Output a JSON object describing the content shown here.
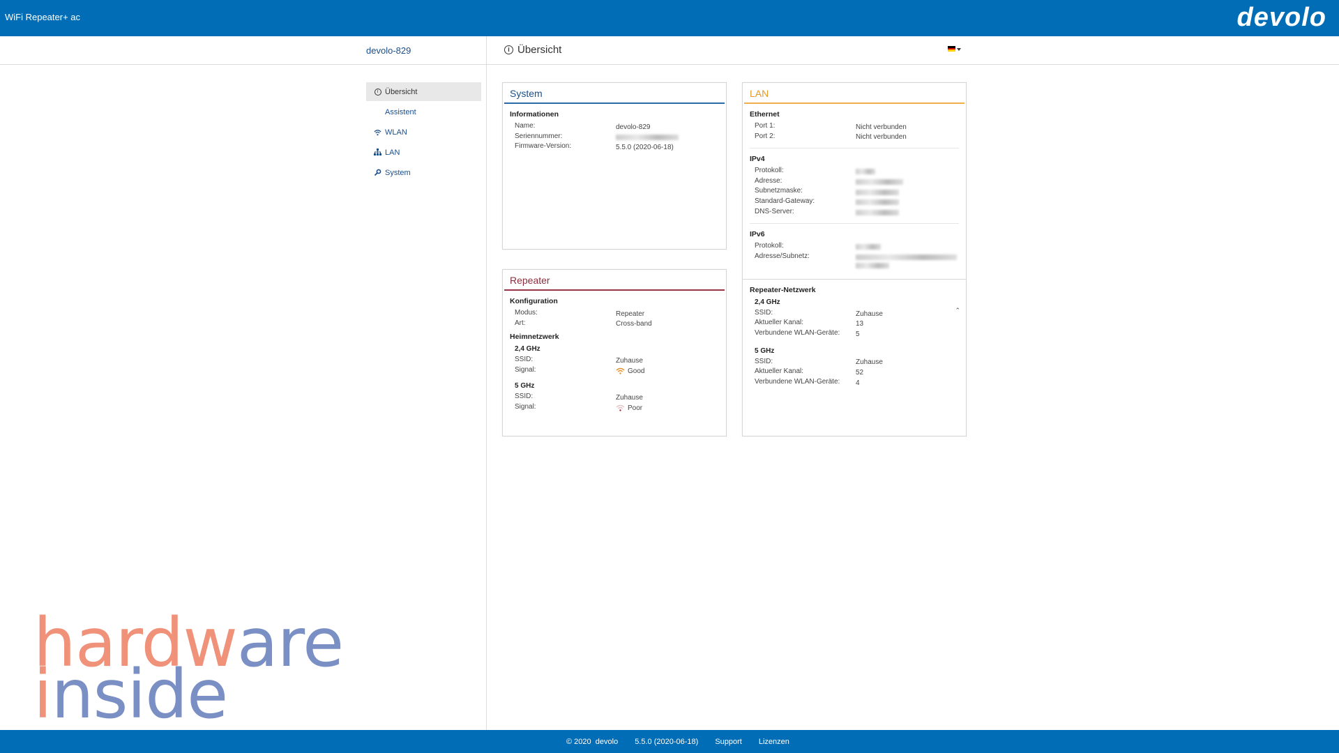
{
  "header": {
    "product": "WiFi Repeater+ ac",
    "brand": "devolo"
  },
  "subbar": {
    "device_name": "devolo-829",
    "page_title": "Übersicht"
  },
  "nav": {
    "items": [
      {
        "label": "Übersicht",
        "icon": "info-icon"
      },
      {
        "label": "Assistent",
        "icon": ""
      },
      {
        "label": "WLAN",
        "icon": "wifi-icon"
      },
      {
        "label": "LAN",
        "icon": "network-icon"
      },
      {
        "label": "System",
        "icon": "gear-icon"
      }
    ]
  },
  "system_card": {
    "title": "System",
    "section": "Informationen",
    "rows": [
      {
        "label": "Name:",
        "value": "devolo-829"
      },
      {
        "label": "Seriennummer:",
        "value": ""
      },
      {
        "label": "Firmware-Version:",
        "value": "5.5.0 (2020-06-18)"
      }
    ]
  },
  "repeater_card": {
    "title": "Repeater",
    "config_section": "Konfiguration",
    "config_rows": [
      {
        "label": "Modus:",
        "value": "Repeater"
      },
      {
        "label": "Art:",
        "value": "Cross-band"
      }
    ],
    "home_section": "Heimnetzwerk",
    "band24": {
      "title": "2,4 GHz",
      "ssid_label": "SSID:",
      "ssid": "Zuhause",
      "signal_label": "Signal:",
      "signal": "Good"
    },
    "band5": {
      "title": "5 GHz",
      "ssid_label": "SSID:",
      "ssid": "Zuhause",
      "signal_label": "Signal:",
      "signal": "Poor"
    }
  },
  "lan_card": {
    "title": "LAN",
    "ethernet_section": "Ethernet",
    "ethernet_rows": [
      {
        "label": "Port 1:",
        "value": "Nicht verbunden"
      },
      {
        "label": "Port 2:",
        "value": "Nicht verbunden"
      }
    ],
    "ipv4_section": "IPv4",
    "ipv4_labels": [
      "Protokoll:",
      "Adresse:",
      "Subnetzmaske:",
      "Standard-Gateway:",
      "DNS-Server:"
    ],
    "ipv6_section": "IPv6",
    "ipv6_labels": [
      "Protokoll:",
      "Adresse/Subnetz:"
    ],
    "repeater_net_section": "Repeater-Netzwerk",
    "band24": {
      "title": "2,4 GHz",
      "rows": [
        {
          "label": "SSID:",
          "value": "Zuhause"
        },
        {
          "label": "Aktueller Kanal:",
          "value": "13"
        },
        {
          "label": "Verbundene WLAN-Geräte:",
          "value": "5"
        }
      ]
    },
    "band5": {
      "title": "5 GHz",
      "rows": [
        {
          "label": "SSID:",
          "value": "Zuhause"
        },
        {
          "label": "Aktueller Kanal:",
          "value": "52"
        },
        {
          "label": "Verbundene WLAN-Geräte:",
          "value": "4"
        }
      ]
    }
  },
  "footer": {
    "copyright": "© 2020",
    "company": "devolo",
    "version": "5.5.0 (2020-06-18)",
    "support": "Support",
    "licenses": "Lizenzen"
  },
  "watermark": {
    "line1_a": "hard",
    "line1_b": "w",
    "line1_c": "are",
    "line2_a": "i",
    "line2_b": "nside"
  },
  "colors": {
    "header_blue": "#006db6",
    "good": "#e8902a",
    "poor": "#b3263a"
  }
}
